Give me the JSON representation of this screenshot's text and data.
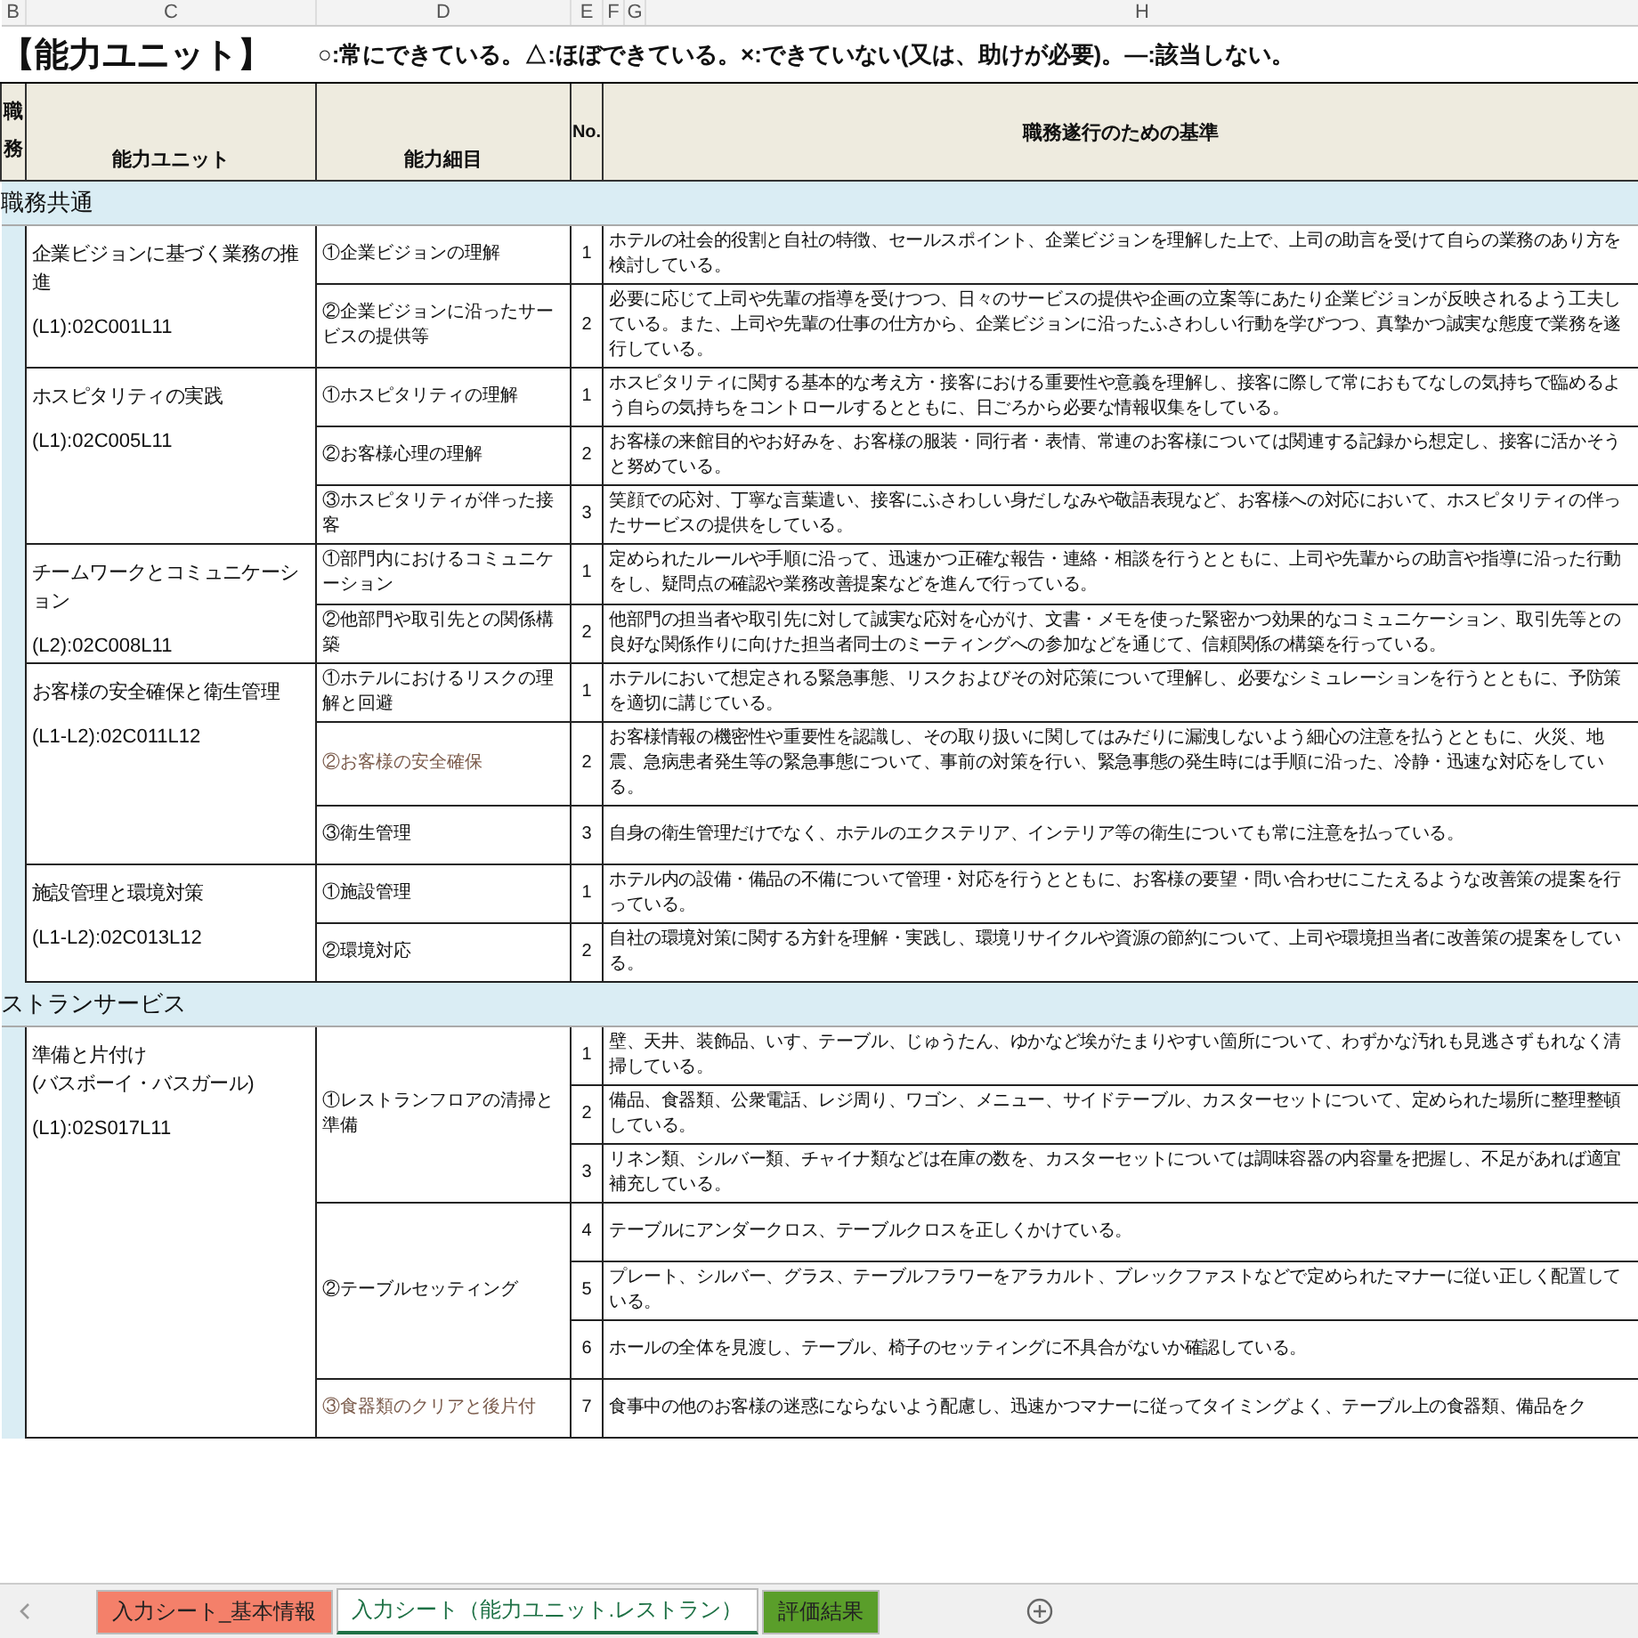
{
  "column_headers": [
    "B",
    "C",
    "D",
    "E",
    "F",
    "G",
    "H"
  ],
  "title": "【能力ユニット】",
  "legend": "○:常にできている。△:ほぼできている。×:できていない(又は、助けが必要)。—:該当しない。",
  "header": {
    "duty": "職務",
    "unit": "能力ユニット",
    "detail": "能力細目",
    "no": "No.",
    "criteria": "職務遂行のための基準"
  },
  "sections": [
    {
      "name": "職務共通",
      "units": [
        {
          "name": [
            "企業ビジョンに基づく業務の推進"
          ],
          "code": "(L1):02C001L11",
          "details": [
            {
              "name": "①企業ビジョンの理解",
              "kind": "plain",
              "criteria": [
                {
                  "no": "1",
                  "text": "ホテルの社会的役割と自社の特徴、セールスポイント、企業ビジョンを理解した上で、上司の助言を受けて自らの業務のあり方を検討している。"
                }
              ]
            },
            {
              "name": "②企業ビジョンに沿ったサービスの提供等",
              "kind": "plain",
              "criteria": [
                {
                  "no": "2",
                  "text": "必要に応じて上司や先輩の指導を受けつつ、日々のサービスの提供や企画の立案等にあたり企業ビジョンが反映されるよう工夫している。また、上司や先輩の仕事の仕方から、企業ビジョンに沿ったふさわしい行動を学びつつ、真摯かつ誠実な態度で業務を遂行している。"
                }
              ]
            }
          ]
        },
        {
          "name": [
            "ホスピタリティの実践"
          ],
          "code": "(L1):02C005L11",
          "details": [
            {
              "name": "①ホスピタリティの理解",
              "kind": "plain",
              "criteria": [
                {
                  "no": "1",
                  "text": "ホスピタリティに関する基本的な考え方・接客における重要性や意義を理解し、接客に際して常におもてなしの気持ちで臨めるよう自らの気持ちをコントロールするとともに、日ごろから必要な情報収集をしている。"
                }
              ]
            },
            {
              "name": "②お客様心理の理解",
              "kind": "plain",
              "criteria": [
                {
                  "no": "2",
                  "text": "お客様の来館目的やお好みを、お客様の服装・同行者・表情、常連のお客様については関連する記録から想定し、接客に活かそうと努めている。"
                }
              ]
            },
            {
              "name": "③ホスピタリティが伴った接客",
              "kind": "plain",
              "criteria": [
                {
                  "no": "3",
                  "text": "笑顔での応対、丁寧な言葉遣い、接客にふさわしい身だしなみや敬語表現など、お客様への対応において、ホスピタリティの伴ったサービスの提供をしている。"
                }
              ]
            }
          ]
        },
        {
          "name": [
            "チームワークとコミュニケーション"
          ],
          "code": "(L2):02C008L11",
          "details": [
            {
              "name": "①部門内におけるコミュニケーション",
              "kind": "plain",
              "criteria": [
                {
                  "no": "1",
                  "text": "定められたルールや手順に沿って、迅速かつ正確な報告・連絡・相談を行うとともに、上司や先輩からの助言や指導に沿った行動をし、疑問点の確認や業務改善提案などを進んで行っている。"
                }
              ]
            },
            {
              "name": "②他部門や取引先との関係構築",
              "kind": "plain",
              "criteria": [
                {
                  "no": "2",
                  "text": "他部門の担当者や取引先に対して誠実な応対を心がけ、文書・メモを使った緊密かつ効果的なコミュニケーション、取引先等との良好な関係作りに向けた担当者同士のミーティングへの参加などを通じて、信頼関係の構築を行っている。"
                }
              ]
            }
          ]
        },
        {
          "name": [
            "お客様の安全確保と衛生管理"
          ],
          "code": "(L1-L2):02C011L12",
          "details": [
            {
              "name": "①ホテルにおけるリスクの理解と回避",
              "kind": "plain",
              "criteria": [
                {
                  "no": "1",
                  "text": "ホテルにおいて想定される緊急事態、リスクおよびその対応策について理解し、必要なシミュレーションを行うとともに、予防策を適切に講じている。"
                }
              ]
            },
            {
              "name": "②お客様の安全確保",
              "kind": "serif",
              "criteria": [
                {
                  "no": "2",
                  "text": "お客様情報の機密性や重要性を認識し、その取り扱いに関してはみだりに漏洩しないよう細心の注意を払うとともに、火災、地震、急病患者発生等の緊急事態について、事前の対策を行い、緊急事態の発生時には手順に沿った、冷静・迅速な対応をしている。"
                }
              ]
            },
            {
              "name": "③衛生管理",
              "kind": "plain",
              "criteria": [
                {
                  "no": "3",
                  "text": "自身の衛生管理だけでなく、ホテルのエクステリア、インテリア等の衛生についても常に注意を払っている。"
                }
              ]
            }
          ]
        },
        {
          "name": [
            "施設管理と環境対策"
          ],
          "code": "(L1-L2):02C013L12",
          "details": [
            {
              "name": "①施設管理",
              "kind": "plain",
              "criteria": [
                {
                  "no": "1",
                  "text": "ホテル内の設備・備品の不備について管理・対応を行うとともに、お客様の要望・問い合わせにこたえるような改善策の提案を行っている。"
                }
              ]
            },
            {
              "name": "②環境対応",
              "kind": "plain",
              "criteria": [
                {
                  "no": "2",
                  "text": "自社の環境対策に関する方針を理解・実践し、環境リサイクルや資源の節約について、上司や環境担当者に改善策の提案をしている。"
                }
              ]
            }
          ]
        }
      ]
    },
    {
      "name": "ストランサービス",
      "units": [
        {
          "name": [
            "準備と片付け",
            "(バスボーイ・バスガール)"
          ],
          "code": "(L1):02S017L11",
          "details": [
            {
              "name": "①レストランフロアの清掃と準備",
              "kind": "plain",
              "criteria": [
                {
                  "no": "1",
                  "text": "壁、天井、装飾品、いす、テーブル、じゅうたん、ゆかなど埃がたまりやすい箇所について、わずかな汚れも見逃さずもれなく清掃している。"
                },
                {
                  "no": "2",
                  "text": "備品、食器類、公衆電話、レジ周り、ワゴン、メニュー、サイドテーブル、カスターセットについて、定められた場所に整理整頓している。"
                },
                {
                  "no": "3",
                  "text": "リネン類、シルバー類、チャイナ類などは在庫の数を、カスターセットについては調味容器の内容量を把握し、不足があれば適宜補充している。"
                }
              ]
            },
            {
              "name": "②テーブルセッティング",
              "kind": "plain",
              "criteria": [
                {
                  "no": "4",
                  "text": "テーブルにアンダークロス、テーブルクロスを正しくかけている。"
                },
                {
                  "no": "5",
                  "text": "プレート、シルバー、グラス、テーブルフラワーをアラカルト、ブレックファストなどで定められたマナーに従い正しく配置している。"
                },
                {
                  "no": "6",
                  "text": "ホールの全体を見渡し、テーブル、椅子のセッティングに不具合がないか確認している。"
                }
              ]
            },
            {
              "name": "③食器類のクリアと後片付",
              "kind": "serif",
              "criteria": [
                {
                  "no": "7",
                  "text": "食事中の他のお客様の迷惑にならないよう配慮し、迅速かつマナーに従ってタイミングよく、テーブル上の食器類、備品をク"
                }
              ]
            }
          ]
        }
      ]
    }
  ],
  "sheet_tabs": [
    {
      "label": "入力シート_基本情報",
      "selected": false,
      "color": "#f4806a"
    },
    {
      "label": "入力シート（能力ユニット.レストラン）",
      "selected": true,
      "color": "#ffffff"
    },
    {
      "label": "評価結果",
      "selected": false,
      "color": "#5a9e2a"
    }
  ]
}
